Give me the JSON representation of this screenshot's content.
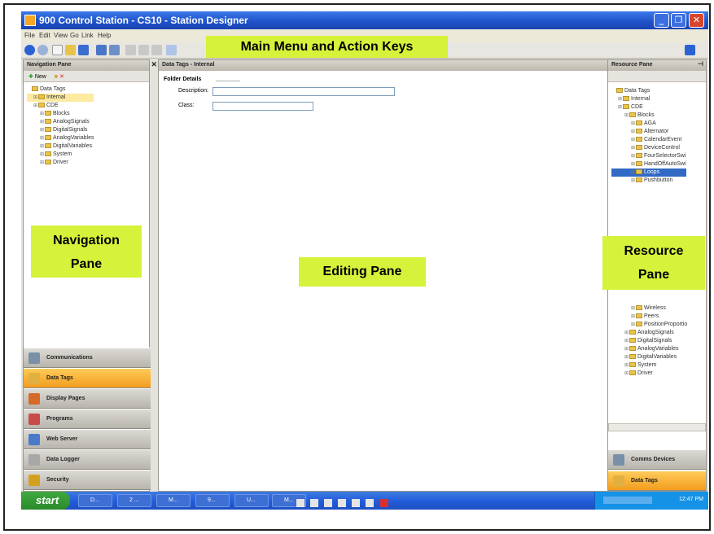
{
  "window": {
    "title": "900 Control Station - CS10 - Station Designer"
  },
  "menu": {
    "items": [
      "File",
      "Edit",
      "View",
      "Go",
      "Link",
      "Help"
    ]
  },
  "annotations": {
    "main_menu": "Main Menu and Action Keys",
    "navigation_line1": "Navigation",
    "navigation_line2": "Pane",
    "editing": "Editing Pane",
    "resource_line1": "Resource",
    "resource_line2": "Pane"
  },
  "nav": {
    "title": "Navigation Pane",
    "new_label": "New",
    "tree": [
      {
        "label": "Data Tags",
        "level": 0
      },
      {
        "label": "Internal",
        "level": 1,
        "selected": true
      },
      {
        "label": "CDE",
        "level": 1
      },
      {
        "label": "Blocks",
        "level": 2
      },
      {
        "label": "AnalogSignals",
        "level": 2
      },
      {
        "label": "DigitalSignals",
        "level": 2
      },
      {
        "label": "AnalogVariables",
        "level": 2
      },
      {
        "label": "DigitalVariables",
        "level": 2
      },
      {
        "label": "System",
        "level": 2
      },
      {
        "label": "Driver",
        "level": 2
      }
    ],
    "buttons": [
      {
        "label": "Communications",
        "active": false,
        "color": "#7a8fa8"
      },
      {
        "label": "Data Tags",
        "active": true,
        "color": "#e0b040"
      },
      {
        "label": "Display Pages",
        "active": false,
        "color": "#d66a2a"
      },
      {
        "label": "Programs",
        "active": false,
        "color": "#c84a4a"
      },
      {
        "label": "Web Server",
        "active": false,
        "color": "#4a7ac8"
      },
      {
        "label": "Data Logger",
        "active": false,
        "color": "#a8a8a8"
      },
      {
        "label": "Security",
        "active": false,
        "color": "#d4a020"
      }
    ]
  },
  "editing": {
    "title": "Data Tags - Internal",
    "section": "Folder Details",
    "description_label": "Description:",
    "description_value": "",
    "class_label": "Class:",
    "class_value": ""
  },
  "resource": {
    "title": "Resource Pane",
    "tree": [
      {
        "label": "Data Tags",
        "level": 0
      },
      {
        "label": "Internal",
        "level": 1
      },
      {
        "label": "CDE",
        "level": 1
      },
      {
        "label": "Blocks",
        "level": 2
      },
      {
        "label": "AGA",
        "level": 3
      },
      {
        "label": "Alternator",
        "level": 3
      },
      {
        "label": "CalendarEvent",
        "level": 3
      },
      {
        "label": "DeviceControl",
        "level": 3
      },
      {
        "label": "FourSelectorSwi",
        "level": 3
      },
      {
        "label": "HandOffAutoSwi",
        "level": 3
      },
      {
        "label": "Loops",
        "level": 3,
        "selected": true
      },
      {
        "label": "Pushbutton",
        "level": 3
      }
    ],
    "tree_lower": [
      {
        "label": "Wireless",
        "level": 3
      },
      {
        "label": "Peers",
        "level": 3
      },
      {
        "label": "PositionProportio",
        "level": 3
      },
      {
        "label": "AnalogSignals",
        "level": 2
      },
      {
        "label": "DigitalSignals",
        "level": 2
      },
      {
        "label": "AnalogVariables",
        "level": 2
      },
      {
        "label": "DigitalVariables",
        "level": 2
      },
      {
        "label": "System",
        "level": 2
      },
      {
        "label": "Driver",
        "level": 2
      }
    ],
    "buttons": [
      {
        "label": "Comms Devices",
        "active": false
      },
      {
        "label": "Data Tags",
        "active": true
      }
    ]
  },
  "taskbar": {
    "start": "start",
    "tasks": [
      "D...",
      "2 ...",
      "M...",
      "9...",
      "U...",
      "M..."
    ],
    "clock": "12:47 PM"
  }
}
